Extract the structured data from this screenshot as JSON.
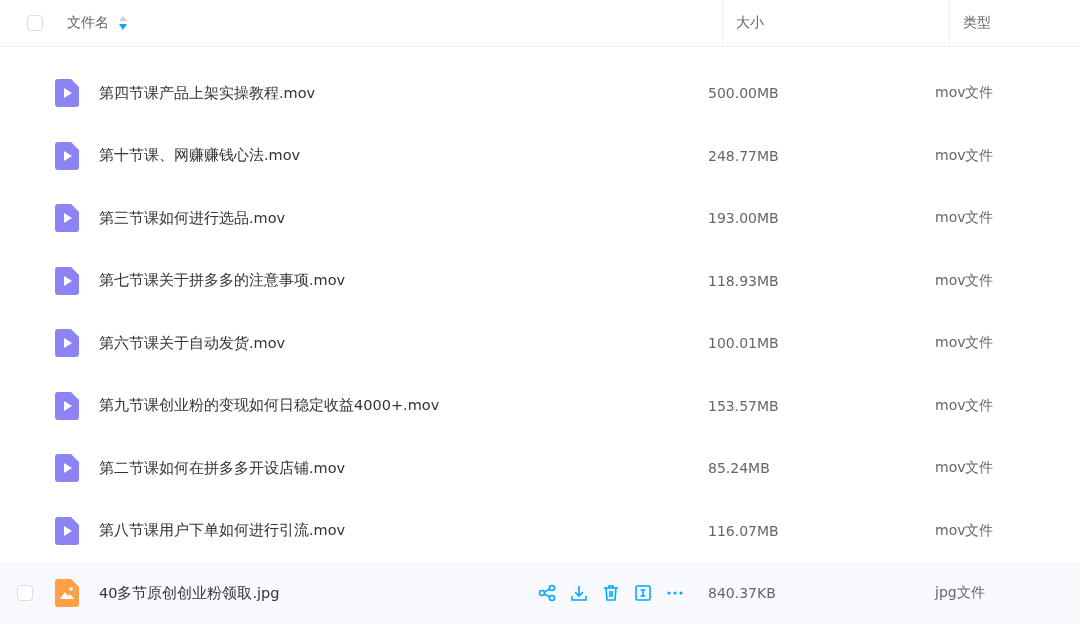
{
  "header": {
    "checked": false,
    "columns": [
      "文件名",
      "大小",
      "类型"
    ]
  },
  "rows": [
    {
      "kind": "video",
      "name": "第四节课产品上架实操教程.mov",
      "size": "500.00MB",
      "type": "mov文件",
      "hovered": false,
      "checked": false
    },
    {
      "kind": "video",
      "name": "第十节课、网赚赚钱心法.mov",
      "size": "248.77MB",
      "type": "mov文件",
      "hovered": false,
      "checked": false
    },
    {
      "kind": "video",
      "name": "第三节课如何进行选品.mov",
      "size": "193.00MB",
      "type": "mov文件",
      "hovered": false,
      "checked": false
    },
    {
      "kind": "video",
      "name": "第七节课关于拼多多的注意事项.mov",
      "size": "118.93MB",
      "type": "mov文件",
      "hovered": false,
      "checked": false
    },
    {
      "kind": "video",
      "name": "第六节课关于自动发货.mov",
      "size": "100.01MB",
      "type": "mov文件",
      "hovered": false,
      "checked": false
    },
    {
      "kind": "video",
      "name": "第九节课创业粉的变现如何日稳定收益4000+.mov",
      "size": "153.57MB",
      "type": "mov文件",
      "hovered": false,
      "checked": false
    },
    {
      "kind": "video",
      "name": "第二节课如何在拼多多开设店铺.mov",
      "size": "85.24MB",
      "type": "mov文件",
      "hovered": false,
      "checked": false
    },
    {
      "kind": "video",
      "name": "第八节课用户下单如何进行引流.mov",
      "size": "116.07MB",
      "type": "mov文件",
      "hovered": false,
      "checked": false
    },
    {
      "kind": "image",
      "name": "40多节原创创业粉领取.jpg",
      "size": "840.37KB",
      "type": "jpg文件",
      "hovered": true,
      "checked": false
    }
  ]
}
